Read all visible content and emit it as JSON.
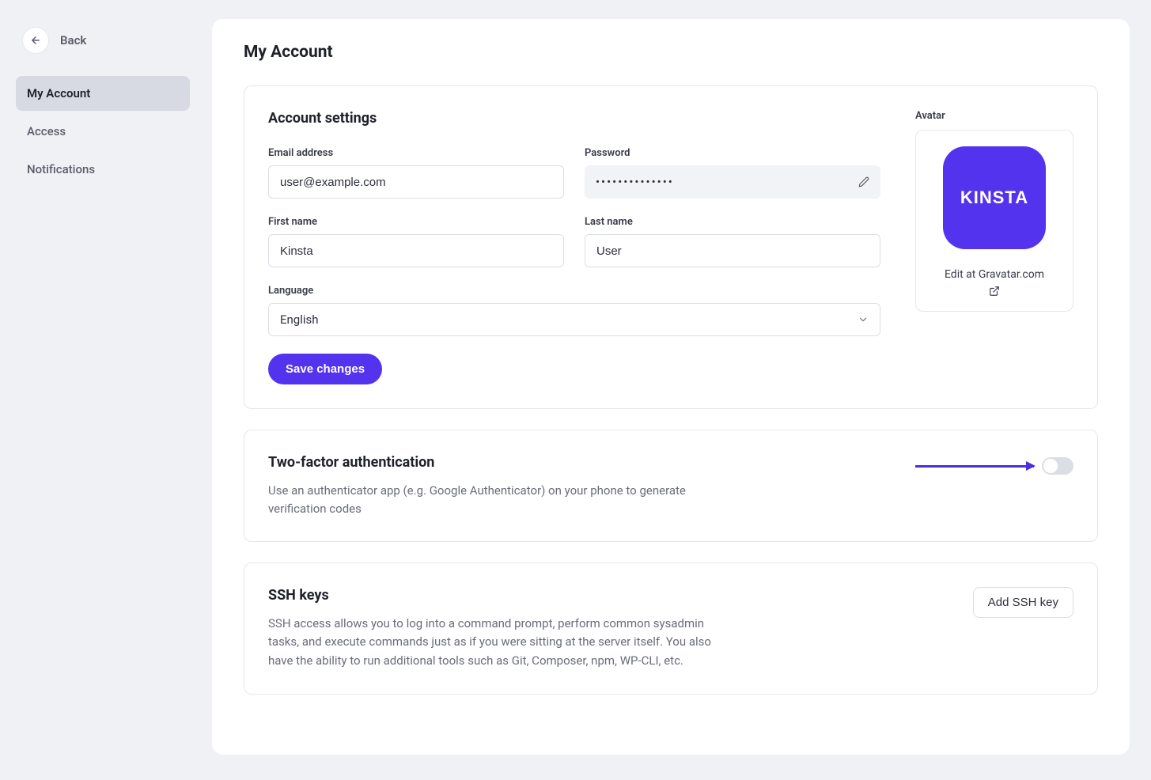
{
  "back": {
    "label": "Back"
  },
  "nav": {
    "items": [
      {
        "label": "My Account",
        "active": true
      },
      {
        "label": "Access",
        "active": false
      },
      {
        "label": "Notifications",
        "active": false
      }
    ]
  },
  "page": {
    "title": "My Account"
  },
  "account": {
    "heading": "Account settings",
    "email_label": "Email address",
    "email_value": "user@example.com",
    "password_label": "Password",
    "password_value": "••••••••••••••",
    "firstname_label": "First name",
    "firstname_value": "Kinsta",
    "lastname_label": "Last name",
    "lastname_value": "User",
    "language_label": "Language",
    "language_value": "English",
    "save_label": "Save changes",
    "avatar_label": "Avatar",
    "avatar_text": "KINSTA",
    "gravatar_link": "Edit at Gravatar.com"
  },
  "twofa": {
    "heading": "Two-factor authentication",
    "description": "Use an authenticator app (e.g. Google Authenticator) on your phone to generate verification codes"
  },
  "ssh": {
    "heading": "SSH keys",
    "description": "SSH access allows you to log into a command prompt, perform common sysadmin tasks, and execute commands just as if you were sitting at the server itself. You also have the ability to run additional tools such as Git, Composer, npm, WP-CLI, etc.",
    "add_label": "Add SSH key"
  }
}
